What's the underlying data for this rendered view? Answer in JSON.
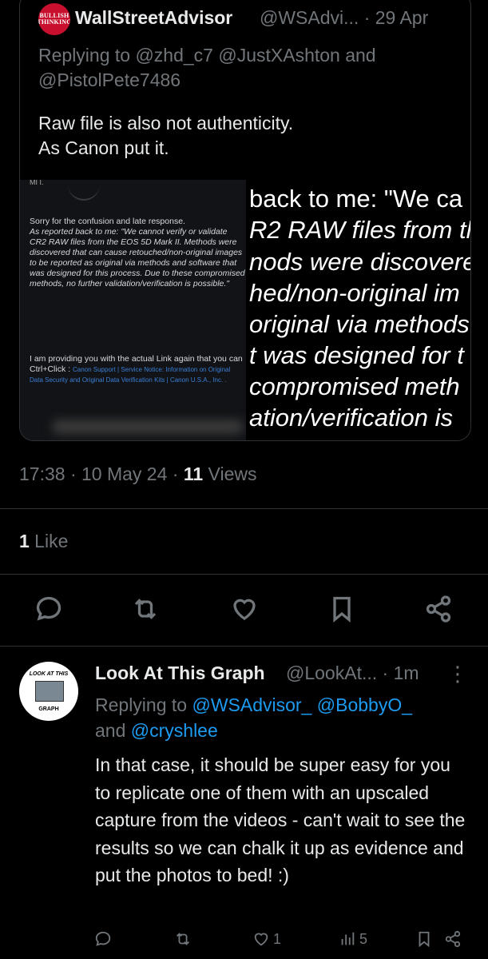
{
  "quoted": {
    "avatar_text": [
      "BULLISH",
      "THINKING"
    ],
    "name": "WallStreetAdvisor",
    "handle": "@WSAdvi...",
    "date": "· 29 Apr",
    "replying_to": "Replying to @zhd_c7 @JustXAshton and @PistolPete7486",
    "text_line1": "Raw file is also not authenticity.",
    "text_line2": "As Canon put it.",
    "image_left": {
      "top_fragment": "MI  I.",
      "para1_a": "Sorry for the confusion and late response.",
      "para1_b": "As reported back to me:  \"We cannot verify or validate CR2 RAW files from the EOS 5D Mark II. Methods were discovered that can cause retouched/non-original images to be reported as original via methods and software that was designed for this process. Due to these compromised methods, no further validation/verification is possible.\"",
      "para2": "I am providing you with the actual Link again that you can Ctrl+Click :",
      "link": "Canon Support | Service Notice: Information on Original Data Security and Original Data Verification Kits | Canon U.S.A., Inc. ."
    },
    "image_right_lines": [
      "back to me:  \"We ca",
      "R2 RAW files from th",
      "nods were discovere",
      "hed/non-original im",
      "original via methods",
      "t was designed for t",
      " compromised meth",
      "ation/verification is"
    ]
  },
  "meta": {
    "time": "17:38 · 10 May 24 · ",
    "views_count": "11",
    "views_label": " Views"
  },
  "likes": {
    "count": "1",
    "label": " Like"
  },
  "actions": [
    "reply-icon",
    "retweet-icon",
    "like-icon",
    "bookmark-icon",
    "share-icon"
  ],
  "reply": {
    "avatar_top": "LOOK AT THIS",
    "avatar_bottom": "GRAPH",
    "name": "Look At This Graph",
    "handle": "@LookAt... · 1m",
    "more": "⋮",
    "replying_prefix": "Replying to ",
    "mention1": "@WSAdvisor_",
    "mention2": "@BobbyO_",
    "and": "and ",
    "mention3": "@cryshlee",
    "text": "In that case, it should be super easy for you to replicate one of them with an upscaled capture from the videos - can't wait to see the results so we can chalk it up as evidence and put the photos to bed! :)",
    "like_count": "1",
    "views_count": "5"
  }
}
